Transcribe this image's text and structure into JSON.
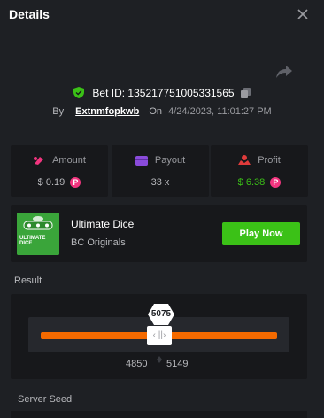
{
  "header": {
    "title": "Details"
  },
  "bet": {
    "id_text": "Bet ID: 135217751005331565",
    "by_label": "By",
    "user": "Extnmfopkwb",
    "on_label": "On",
    "date": "4/24/2023, 11:01:27 PM"
  },
  "stats": {
    "amount": {
      "label": "Amount",
      "value": "$ 0.19"
    },
    "payout": {
      "label": "Payout",
      "value": "33 x"
    },
    "profit": {
      "label": "Profit",
      "value": "$ 6.38"
    }
  },
  "game": {
    "thumb_text": "ULTIMATE DICE",
    "name": "Ultimate Dice",
    "provider": "BC Originals",
    "play_label": "Play Now"
  },
  "result": {
    "label": "Result",
    "value": "5075",
    "range_low": "4850",
    "range_high": "5149",
    "handle_glyph": "‹ ||› "
  },
  "server_seed": {
    "label": "Server Seed"
  },
  "colors": {
    "background": "#1e2024",
    "panel": "#17181b",
    "accent_green": "#3bc117",
    "accent_orange": "#f46a00",
    "coin_pink": "#f2357f",
    "profit_green": "#3bc117"
  }
}
